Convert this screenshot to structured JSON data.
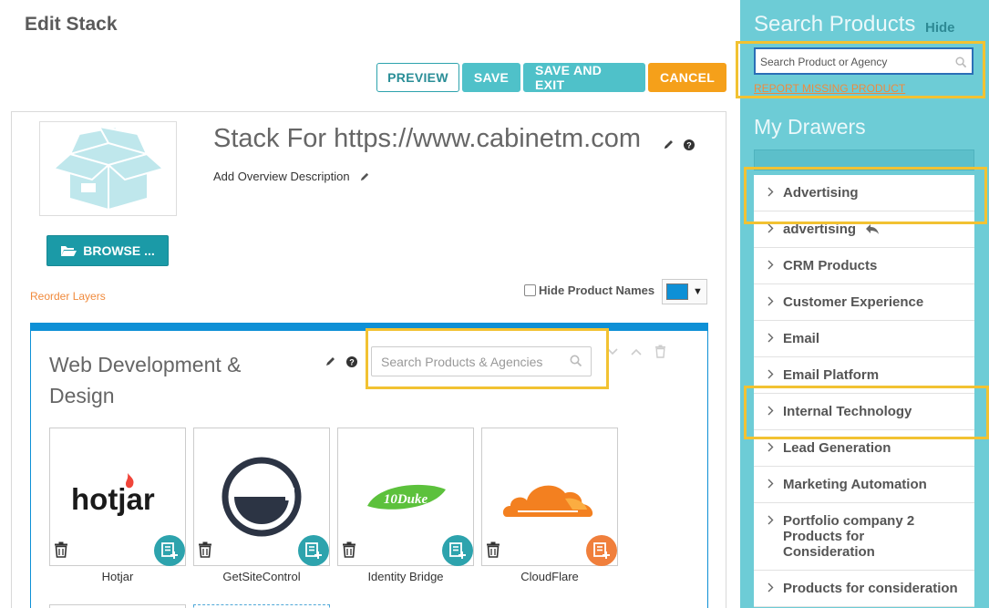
{
  "page": {
    "title": "Edit Stack"
  },
  "toolbar": {
    "preview": "PREVIEW",
    "save": "SAVE",
    "save_exit": "SAVE AND EXIT",
    "cancel": "CANCEL"
  },
  "stack": {
    "title": "Stack For https://www.cabinetm.com",
    "add_description": "Add Overview Description",
    "browse_label": "BROWSE ...",
    "reorder_label": "Reorder Layers",
    "hide_names_label": "Hide Product Names",
    "hide_names_checked": false,
    "layer_color": "#0e90d6"
  },
  "layer": {
    "title": "Web Development & Design",
    "search_placeholder": "Search Products & Agencies",
    "products": [
      {
        "name": "Hotjar",
        "note_state": "teal"
      },
      {
        "name": "GetSiteControl",
        "note_state": "teal"
      },
      {
        "name": "Identity Bridge",
        "note_state": "teal"
      },
      {
        "name": "CloudFlare",
        "note_state": "orange"
      }
    ]
  },
  "sidebar": {
    "heading": "Search Products",
    "hide_label": "Hide",
    "search_placeholder": "Search Product or Agency",
    "report_label": "REPORT MISSING PRODUCT",
    "drawers_heading": "My Drawers",
    "drawers": [
      "Advertising",
      "advertising",
      "CRM Products",
      "Customer Experience",
      "Email",
      "Email Platform",
      "Internal Technology",
      "Lead Generation",
      "Marketing Automation",
      "Portfolio company 2 Products for Consideration",
      "Products for consideration"
    ]
  },
  "colors": {
    "teal": "#1b9aa7",
    "accent_orange": "#f5a01a",
    "highlight": "#f2c232",
    "sidebar_bg": "#6dccd6"
  }
}
